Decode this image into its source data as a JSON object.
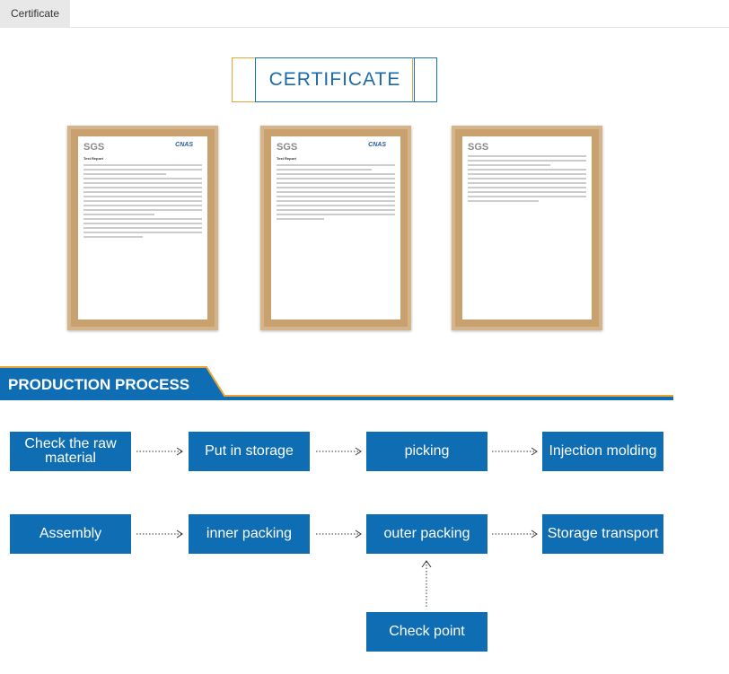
{
  "tab": {
    "label": "Certificate"
  },
  "certificate": {
    "title": "CERTIFICATE"
  },
  "documents": [
    {
      "logo": "SGS",
      "accreditation": "CNAS",
      "heading": "Test Report"
    },
    {
      "logo": "SGS",
      "accreditation": "CNAS",
      "heading": "Test Report"
    },
    {
      "logo": "SGS",
      "accreditation": "",
      "heading": ""
    }
  ],
  "production": {
    "title": "PRODUCTION PROCESS",
    "steps": [
      "Check the raw material",
      "Put in storage",
      "picking",
      "Injection molding",
      "Assembly",
      "inner packing",
      "outer packing",
      "Storage transport",
      "Check point"
    ]
  },
  "colors": {
    "blue": "#0f6db3",
    "orange": "#e8a536"
  }
}
